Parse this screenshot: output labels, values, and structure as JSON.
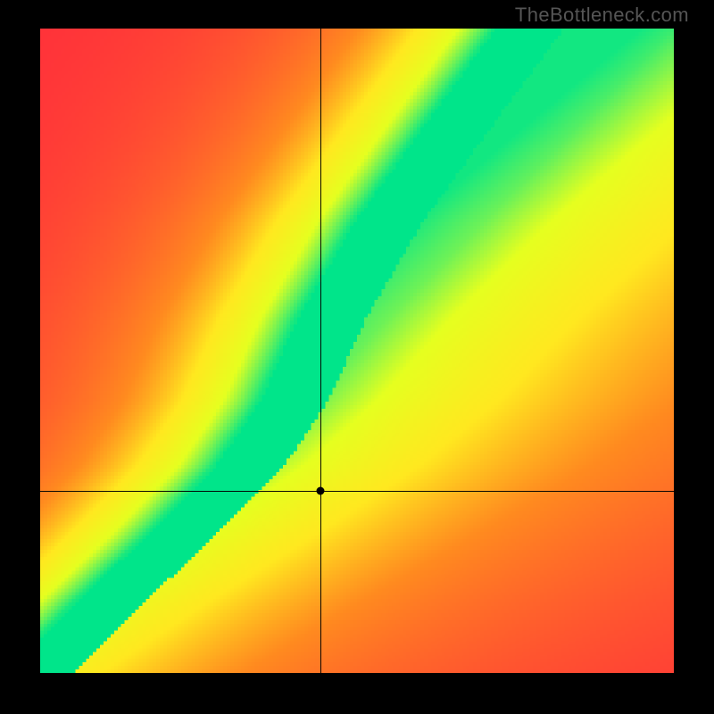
{
  "watermark": "TheBottleneck.com",
  "chart_data": {
    "type": "heatmap",
    "title": "",
    "xlabel": "",
    "ylabel": "",
    "xlim": [
      0,
      1
    ],
    "ylim": [
      0,
      1
    ],
    "grid": false,
    "legend": false,
    "colorscale": [
      {
        "stop": 0.0,
        "color": "#ff2a3c"
      },
      {
        "stop": 0.35,
        "color": "#ff8a1f"
      },
      {
        "stop": 0.55,
        "color": "#ffe81f"
      },
      {
        "stop": 0.75,
        "color": "#e5ff1f"
      },
      {
        "stop": 1.0,
        "color": "#00e58a"
      }
    ],
    "ridge": {
      "description": "green band of good-fit running roughly diagonal with slight S-curve",
      "points": [
        {
          "x": 0.02,
          "y": 0.02
        },
        {
          "x": 0.1,
          "y": 0.1
        },
        {
          "x": 0.22,
          "y": 0.21
        },
        {
          "x": 0.33,
          "y": 0.32
        },
        {
          "x": 0.4,
          "y": 0.42
        },
        {
          "x": 0.46,
          "y": 0.55
        },
        {
          "x": 0.55,
          "y": 0.7
        },
        {
          "x": 0.66,
          "y": 0.85
        },
        {
          "x": 0.75,
          "y": 0.97
        }
      ],
      "band_width_fraction": 0.06
    },
    "marker": {
      "x": 0.442,
      "y": 0.283
    },
    "crosshair": {
      "x": 0.442,
      "y": 0.283
    },
    "background_extremes": {
      "top_left": "red",
      "bottom_right": "red",
      "top_right": "yellow",
      "bottom_left_corner": "dark-red"
    }
  }
}
